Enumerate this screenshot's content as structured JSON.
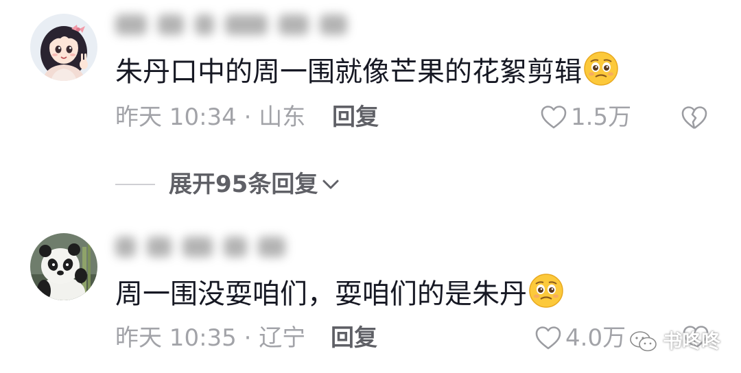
{
  "comments": [
    {
      "text": "朱丹口中的周一围就像芒果的花絮剪辑",
      "emoji": "pleading-face-emoji",
      "timestamp": "昨天 10:34 ·",
      "location": "山东",
      "reply_label": "回复",
      "likes": "1.5万",
      "avatar": "anime-girl-avatar"
    },
    {
      "text": "周一围没耍咱们，耍咱们的是朱丹",
      "emoji": "pleading-face-emoji",
      "timestamp": "昨天 10:35 ·",
      "location": "辽宁",
      "reply_label": "回复",
      "likes": "4.0万",
      "avatar": "panda-avatar"
    }
  ],
  "expand_replies": {
    "label": "展开95条回复"
  },
  "watermark": {
    "text": "书咚咚"
  },
  "colors": {
    "text_primary": "#161823",
    "text_secondary": "#a2a3a8",
    "background": "#ffffff"
  }
}
